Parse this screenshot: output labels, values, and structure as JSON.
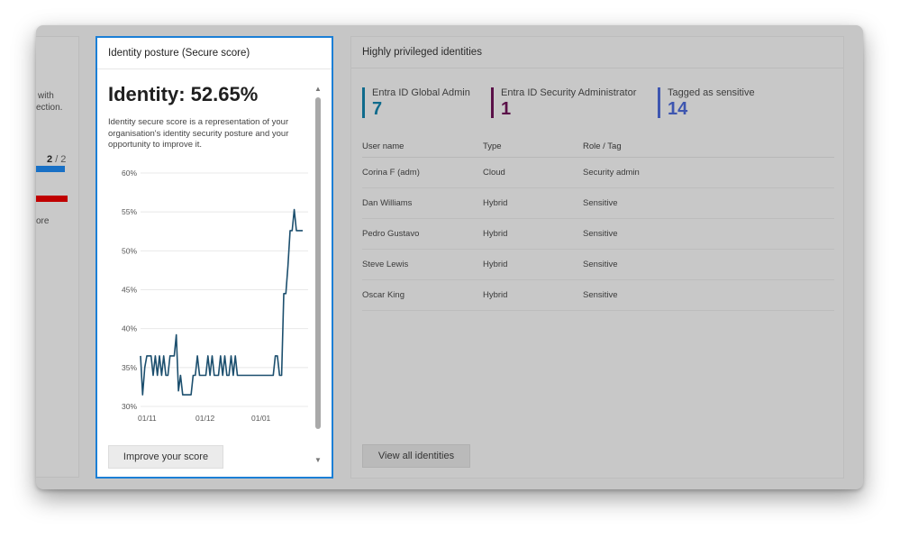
{
  "left_card": {
    "text_line1": "with",
    "text_line2": "ection.",
    "fraction_value": "2",
    "fraction_total": "/ 2",
    "text_line3": "ore",
    "bar_colors": [
      "#1870c5",
      "#c00000"
    ]
  },
  "secure_card": {
    "title": "Identity posture (Secure score)",
    "score_text": "Identity: 52.65%",
    "description": "Identity secure score is a representation of your organisation's identity security posture and your opportunity to improve it.",
    "improve_button": "Improve your score",
    "scroll_up_icon": "▲",
    "scroll_down_icon": "▼",
    "accent_color": "#1b7fd6"
  },
  "chart_data": {
    "type": "line",
    "title": "",
    "xlabel": "",
    "ylabel": "",
    "x_tick_labels": [
      "01/11",
      "01/12",
      "01/01"
    ],
    "y_tick_labels": [
      "30%",
      "35%",
      "40%",
      "45%",
      "50%",
      "55%",
      "60%"
    ],
    "ylim": [
      30,
      60
    ],
    "grid": true,
    "line_color": "#1c4f6e",
    "series": [
      {
        "values": [
          36.5,
          31.5,
          35,
          36.5,
          36.5,
          36.5,
          34,
          36.5,
          34,
          36.5,
          34,
          36.5,
          34,
          34,
          36.5,
          36.5,
          36.5,
          39.2,
          32,
          34,
          31.5,
          31.5,
          31.5,
          31.5,
          31.5,
          34,
          34,
          36.5,
          34,
          34,
          34,
          34,
          36.5,
          34,
          36.5,
          34,
          34,
          34,
          36.5,
          34,
          36.5,
          34,
          34,
          36.5,
          34,
          36.5,
          34,
          34,
          34,
          34,
          34,
          34,
          34,
          34,
          34,
          34,
          34,
          34,
          34,
          34,
          34,
          34,
          34,
          34,
          36.5,
          36.5,
          34,
          34,
          44.5,
          44.5,
          48,
          52.6,
          52.6,
          55.3,
          52.6,
          52.6,
          52.6,
          52.6
        ]
      }
    ]
  },
  "priv_card": {
    "title": "Highly privileged identities",
    "stats": [
      {
        "label": "Entra ID Global Admin",
        "value": "7",
        "color": "#0f6b8c"
      },
      {
        "label": "Entra ID Security Administrator",
        "value": "1",
        "color": "#5a1048"
      },
      {
        "label": "Tagged as sensitive",
        "value": "14",
        "color": "#3e56b0"
      }
    ],
    "columns": [
      "User name",
      "Type",
      "Role / Tag"
    ],
    "rows": [
      [
        "Corina F (adm)",
        "Cloud",
        "Security admin"
      ],
      [
        "Dan Williams",
        "Hybrid",
        "Sensitive"
      ],
      [
        "Pedro Gustavo",
        "Hybrid",
        "Sensitive"
      ],
      [
        "Steve Lewis",
        "Hybrid",
        "Sensitive"
      ],
      [
        "Oscar King",
        "Hybrid",
        "Sensitive"
      ]
    ],
    "view_button": "View all identities"
  }
}
